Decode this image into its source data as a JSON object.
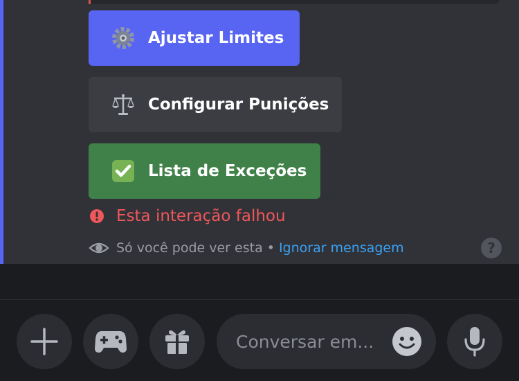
{
  "buttons": {
    "adjust_limits": "Ajustar Limites",
    "configure_punishments": "Configurar Punições",
    "exceptions_list": "Lista de Exceções"
  },
  "status": {
    "error_text": "Esta interação falhou",
    "ephemeral_text": "Só você pode ver esta",
    "separator": "•",
    "dismiss_link": "Ignorar mensagem",
    "help_symbol": "?"
  },
  "composer": {
    "placeholder": "Conversar em..."
  },
  "colors": {
    "blurple": "#5865f2",
    "green": "#3f8148",
    "error": "#f0575a",
    "link": "#3aa1f0"
  }
}
